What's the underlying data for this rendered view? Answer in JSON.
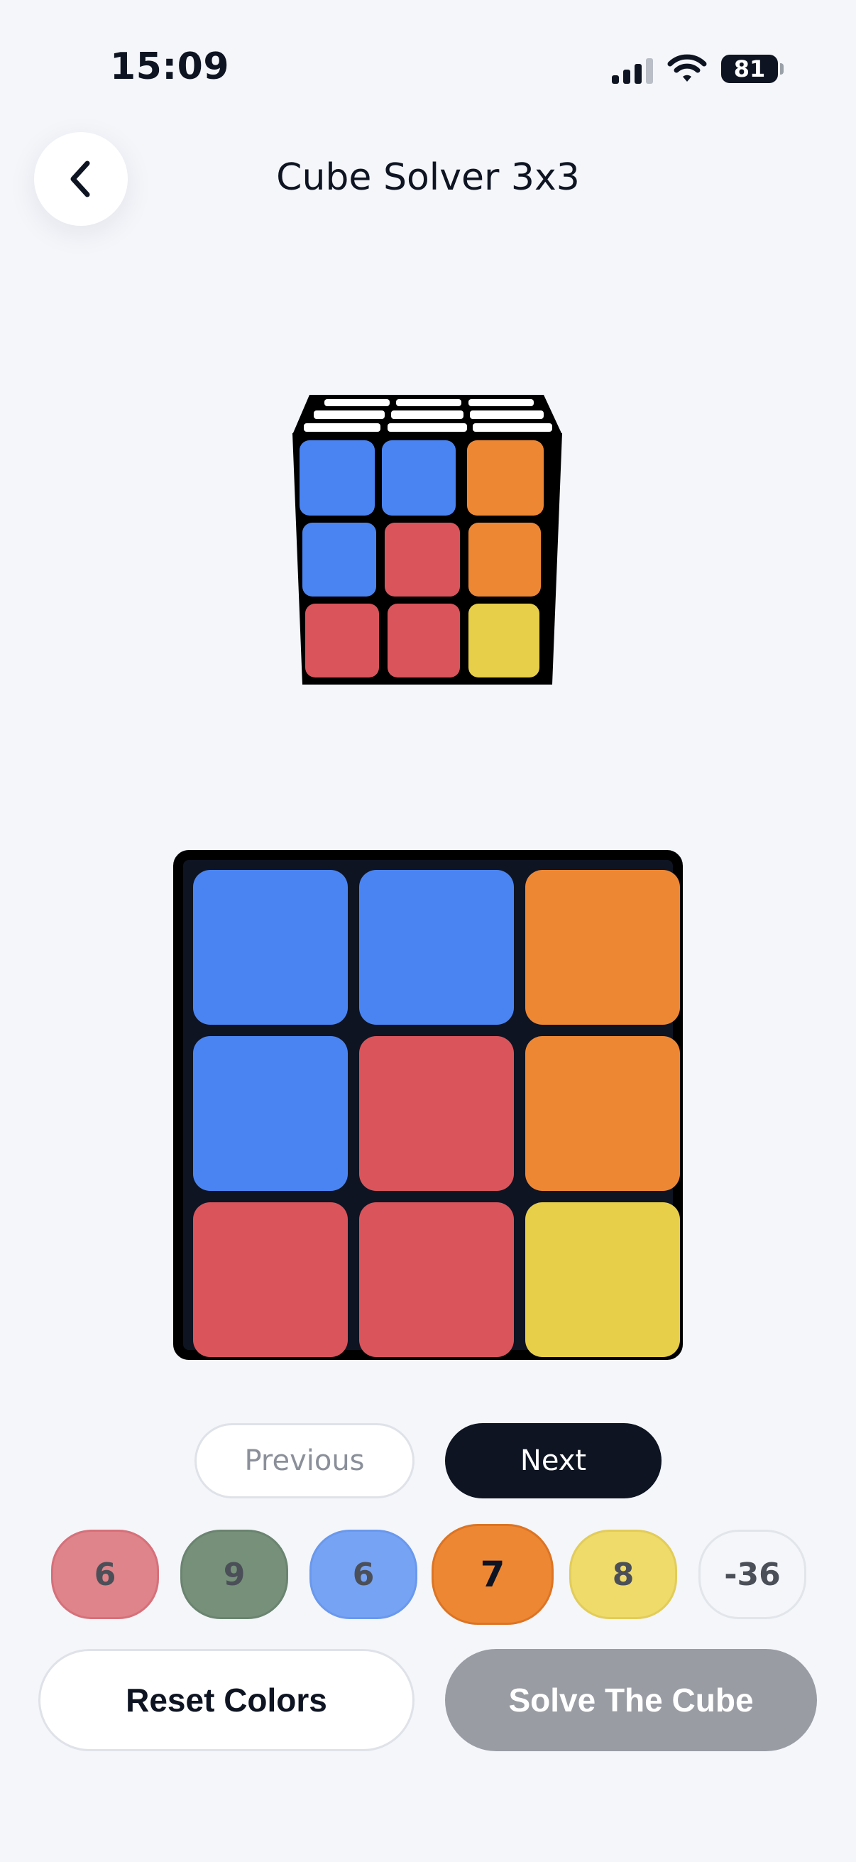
{
  "status_bar": {
    "time": "15:09",
    "battery": "81"
  },
  "header": {
    "title": "Cube Solver 3x3",
    "back_icon": "chevron-left-icon"
  },
  "colors": {
    "red": "#d9545b",
    "blue": "#4a84f2",
    "orange": "#ee8734",
    "yellow": "#e8cf4a",
    "green": "#76907a",
    "white": "#ffffff"
  },
  "face": {
    "cells": [
      "blue",
      "blue",
      "orange",
      "blue",
      "red",
      "orange",
      "red",
      "red",
      "yellow"
    ]
  },
  "navigation": {
    "previous_label": "Previous",
    "next_label": "Next"
  },
  "counters": [
    {
      "color": "red",
      "value": "6",
      "selected": false
    },
    {
      "color": "green",
      "value": "9",
      "selected": false
    },
    {
      "color": "blue",
      "value": "6",
      "selected": false
    },
    {
      "color": "orange",
      "value": "7",
      "selected": true
    },
    {
      "color": "yellow",
      "value": "8",
      "selected": false
    },
    {
      "color": "white",
      "value": "-36",
      "selected": false
    }
  ],
  "actions": {
    "reset_label": "Reset Colors",
    "solve_label": "Solve The Cube"
  }
}
